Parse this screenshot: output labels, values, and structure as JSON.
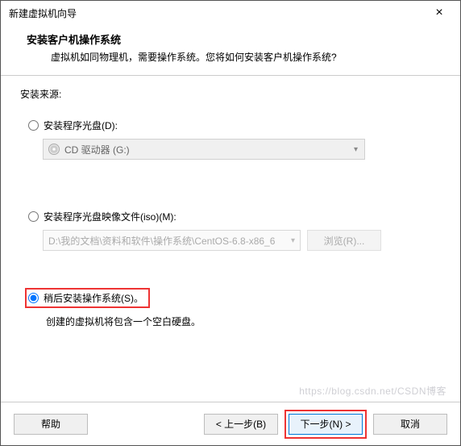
{
  "titlebar": {
    "text": "新建虚拟机向导"
  },
  "header": {
    "title": "安装客户机操作系统",
    "sub": "虚拟机如同物理机，需要操作系统。您将如何安装客户机操作系统?"
  },
  "source_label": "安装来源:",
  "option_disc": {
    "label": "安装程序光盘(D):",
    "combo_text": "CD 驱动器 (G:)"
  },
  "option_iso": {
    "label": "安装程序光盘映像文件(iso)(M):",
    "path": "D:\\我的文档\\资料和软件\\操作系统\\CentOS-6.8-x86_6",
    "browse": "浏览(R)..."
  },
  "option_later": {
    "label": "稍后安装操作系统(S)。",
    "desc": "创建的虚拟机将包含一个空白硬盘。"
  },
  "footer": {
    "help": "帮助",
    "back": "< 上一步(B)",
    "next": "下一步(N) >",
    "cancel": "取消"
  },
  "watermark": "https://blog.csdn.net/CSDN博客"
}
